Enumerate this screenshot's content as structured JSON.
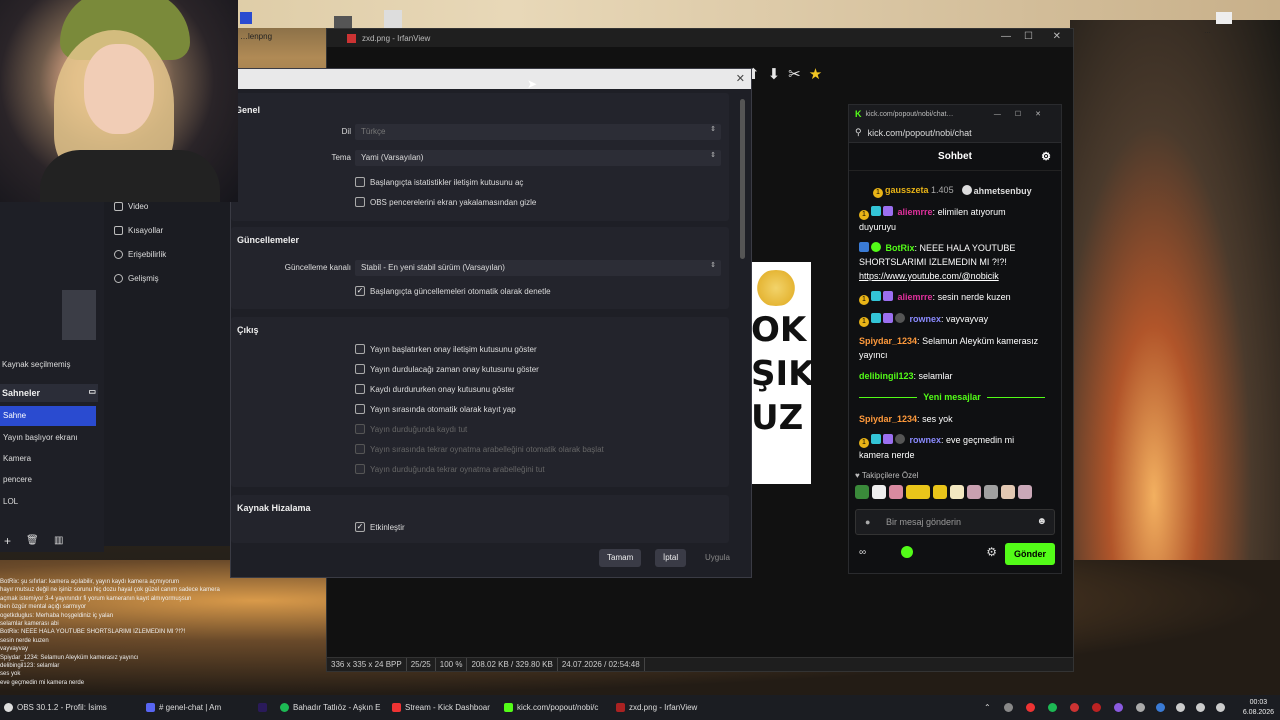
{
  "desktop": {
    "icon_label": "…lenpng",
    "top_right_label": "…"
  },
  "irfanview": {
    "title": "zxd.png - IrfanView",
    "status": [
      "336 x 335 x 24 BPP",
      "25/25",
      "100 %",
      "208.02 KB / 329.80 KB",
      "24.07.2026 / 02:54:48"
    ],
    "sticker_text": [
      "OK",
      "ŞIK",
      "UZ"
    ]
  },
  "obs": {
    "source_none": "Kaynak seçilmemiş",
    "scenes_header": "Sahneler",
    "scenes": [
      "Sahne",
      "Yayın başlıyor ekranı",
      "Kamera",
      "pencere",
      "LOL"
    ],
    "settings_menu": [
      "Video",
      "Kısayollar",
      "Erişebilirlik",
      "Gelişmiş"
    ]
  },
  "settings": {
    "general": {
      "title": "Genel",
      "language_label": "Dil",
      "language_value": "Türkçe",
      "theme_label": "Tema",
      "theme_value": "Yami (Varsayılan)",
      "checkboxes": [
        {
          "label": "Başlangıçta istatistikler iletişim kutusunu aç",
          "checked": false
        },
        {
          "label": "OBS pencerelerini ekran yakalamasından gizle",
          "checked": false
        }
      ]
    },
    "updates": {
      "title": "Güncellemeler",
      "channel_label": "Güncelleme kanalı",
      "channel_value": "Stabil - En yeni stabil sürüm (Varsayılan)",
      "auto_check": "Başlangıçta güncellemeleri otomatik olarak denetle",
      "auto_check_checked": true
    },
    "output": {
      "title": "Çıkış",
      "checkboxes": [
        {
          "label": "Yayın başlatırken onay iletişim kutusunu göster",
          "checked": false,
          "disabled": false
        },
        {
          "label": "Yayın durdulacağı zaman onay kutusunu göster",
          "checked": false,
          "disabled": false
        },
        {
          "label": "Kaydı durdururken onay kutusunu göster",
          "checked": false,
          "disabled": false
        },
        {
          "label": "Yayın sırasında otomatik olarak kayıt yap",
          "checked": false,
          "disabled": false
        },
        {
          "label": "Yayın durduğunda kaydı tut",
          "checked": false,
          "disabled": true
        },
        {
          "label": "Yayın sırasında tekrar oynatma arabelleğini otomatik olarak başlat",
          "checked": false,
          "disabled": true
        },
        {
          "label": "Yayın durduğunda tekrar oynatma arabelleğini tut",
          "checked": false,
          "disabled": true
        }
      ]
    },
    "snapping": {
      "title": "Kaynak Hizalama",
      "enable_label": "Etkinleştir",
      "enable_checked": true
    },
    "buttons": {
      "ok": "Tamam",
      "cancel": "İptal",
      "apply": "Uygula"
    }
  },
  "chat": {
    "window_title": "kick.com/popout/nobi/chat…",
    "url": "kick.com/popout/nobi/chat",
    "header": "Sohbet",
    "pinned": [
      {
        "user": "gausszeta",
        "amount": "1.405"
      },
      {
        "user": "ahmetsenbuy",
        "amount": ""
      }
    ],
    "messages": [
      {
        "user": "aliemrre",
        "color": "#e0309c",
        "text": "elimilen atıyorum duyuruyu",
        "badges": [
          "1",
          "sq",
          "pu"
        ]
      },
      {
        "user": "BotRix",
        "color": "#53fc18",
        "text": "NEEE HALA YOUTUBE SHORTSLARIMI IZLEMEDIN MI ?!?! ",
        "link": "https://www.youtube.com/@nobicik",
        "badges": [
          "bl",
          "gr"
        ]
      },
      {
        "user": "aliemrre",
        "color": "#e0309c",
        "text": "sesin nerde kuzen",
        "badges": [
          "1",
          "sq",
          "pu"
        ]
      },
      {
        "user": "rownex",
        "color": "#8b8bff",
        "text": "vayvayvay",
        "badges": [
          "1",
          "sq",
          "pu",
          "av"
        ]
      },
      {
        "user": "Spiydar_1234",
        "color": "#ff9a3c",
        "text": "Selamun Aleyküm kamerasız yayıncı",
        "badges": []
      },
      {
        "user": "delibingil123",
        "color": "#53fc18",
        "text": "selamlar",
        "badges": []
      }
    ],
    "new_messages_label": "Yeni mesajlar",
    "messages_after": [
      {
        "user": "Spiydar_1234",
        "color": "#ff9a3c",
        "text": "ses yok",
        "badges": []
      },
      {
        "user": "rownex",
        "color": "#8b8bff",
        "text": "eve geçmedin mi kamera nerde",
        "badges": [
          "1",
          "sq",
          "pu",
          "av"
        ]
      }
    ],
    "followers_only": "Takipçilere Özel",
    "input_placeholder": "Bir mesaj gönderin",
    "send_label": "Gönder"
  },
  "overlay_chat": [
    "BotRix: şu sıfırlar: kamera açılabilir, yayın kaydı kamera açmıyorum",
    "hayır mutsuz değil ne işiniz sorunu hiç dozu hayal çok güzel canım sadece kamera",
    "açmak istemiyor 3-4 yayınındır fi yorum kameranın kayıt almıyormuşsun",
    "ben özgür mental açığı sarmıyor",
    "ogetkduglus: Merhaba hoşgeldiniz iç yalan",
    "selamlar kamerası abi",
    "BotRix: NEEE HALA YOUTUBE SHORTSLARIMI IZLEMEDIN MI ?!?!",
    "sesin nerde kuzen",
    "vayvayvay",
    "Spiydar_1234: Selamun Aleyküm kamerasız yayıncı",
    "delibingil123: selamlar",
    "ses yok",
    "eve geçmedin mi kamera nerde"
  ],
  "taskbar": {
    "items": [
      "OBS 30.1.2 - Profil: İsims",
      "# genel-chat | Am",
      "Bahadır Tatlıöz - Aşkın E",
      "Stream - Kick Dashboar",
      "kick.com/popout/nobi/c",
      "zxd.png - IrfanView"
    ],
    "time": "00:03",
    "date": "6.08.2026"
  }
}
